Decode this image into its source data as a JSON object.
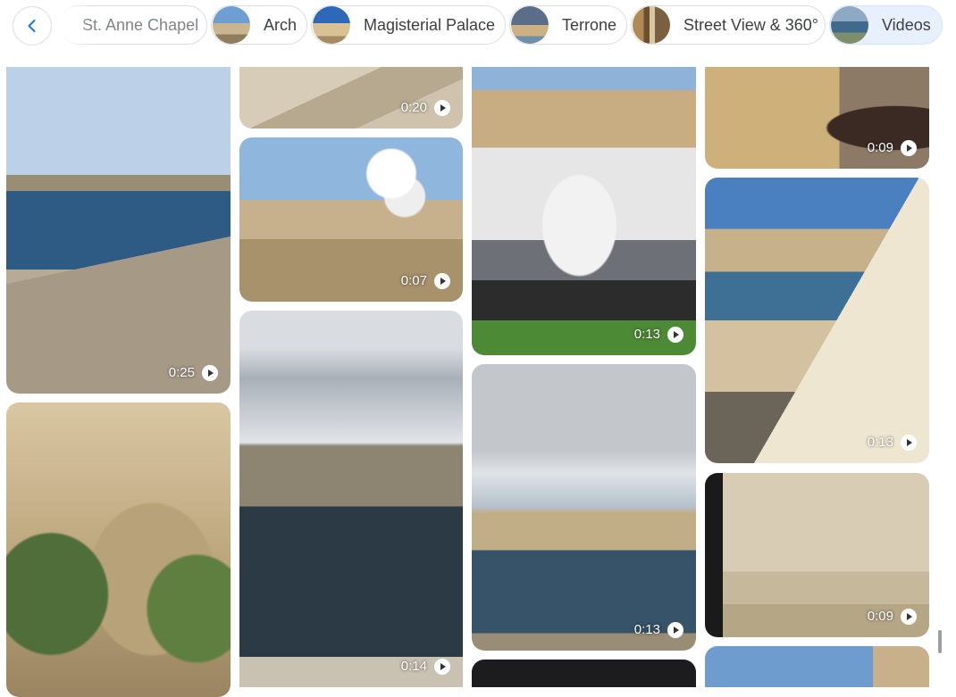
{
  "chips": [
    {
      "label": "St. Anne Chapel",
      "icon": "place-thumbnail"
    },
    {
      "label": "Arch",
      "icon": "place-thumbnail"
    },
    {
      "label": "Magisterial Palace",
      "icon": "place-thumbnail"
    },
    {
      "label": "Terrone",
      "icon": "place-thumbnail"
    },
    {
      "label": "Street View & 360°",
      "icon": "place-thumbnail"
    },
    {
      "label": "Videos",
      "icon": "place-thumbnail",
      "selected": true
    }
  ],
  "back_icon": "chevron-left-icon",
  "videos": {
    "col1": [
      {
        "duration": "0:25",
        "scene": "Harbour view from stone bastion"
      },
      {
        "duration": "",
        "scene": "Stone archway with olive tree"
      }
    ],
    "col2": [
      {
        "duration": "0:20",
        "scene": "Stone wall close-up"
      },
      {
        "duration": "0:07",
        "scene": "Saluting battery cannon smoke"
      },
      {
        "duration": "0:14",
        "scene": "Grand Harbour under cloudy sky"
      }
    ],
    "col3": [
      {
        "duration": "0:13",
        "scene": "Superyacht moored in marina"
      },
      {
        "duration": "0:13",
        "scene": "Harbour and peninsula at dusk"
      },
      {
        "duration": "",
        "scene": "Dark clip"
      }
    ],
    "col4": [
      {
        "duration": "0:09",
        "scene": "Person photographing skyline"
      },
      {
        "duration": "0:13",
        "scene": "Fort buildings and waterfront"
      },
      {
        "duration": "0:09",
        "scene": "Projection of old map on wall"
      },
      {
        "duration": "",
        "scene": "Sky above stone building"
      }
    ]
  },
  "colors": {
    "accent": "#1a73e8",
    "chip_selected_bg": "#e8f0fe"
  }
}
